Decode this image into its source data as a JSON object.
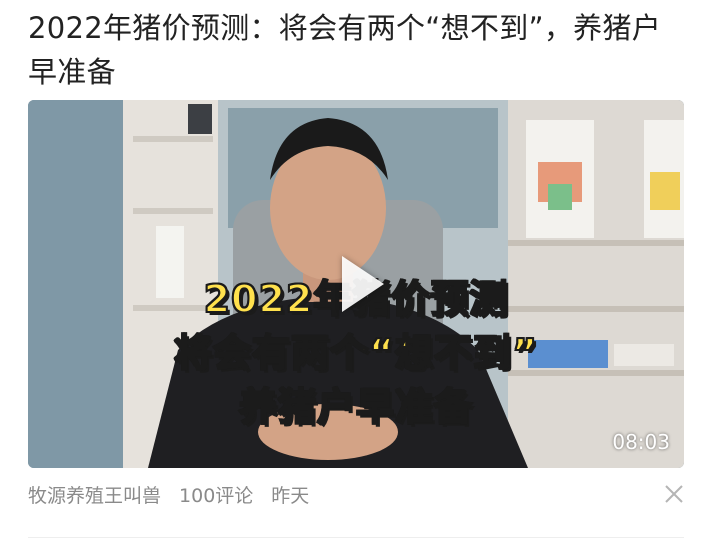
{
  "article": {
    "title": "2022年猪价预测：将会有两个“想不到”，养猪户早准备",
    "video": {
      "caption_line1": "2022年猪价预测",
      "caption_line2": "将会有两个“想不到”",
      "caption_line3": "养猪户早准备",
      "duration": "08:03",
      "play_icon": "play-icon"
    },
    "meta": {
      "author": "牧源养殖王叫兽",
      "comments": "100评论",
      "time": "昨天"
    },
    "dismiss_icon": "close-icon"
  },
  "colors": {
    "title_text": "#222222",
    "meta_text": "#8a8a8a",
    "caption_fill": "#ffe14d",
    "caption_stroke": "#1b1b1b",
    "duration_text": "#ffffff"
  }
}
